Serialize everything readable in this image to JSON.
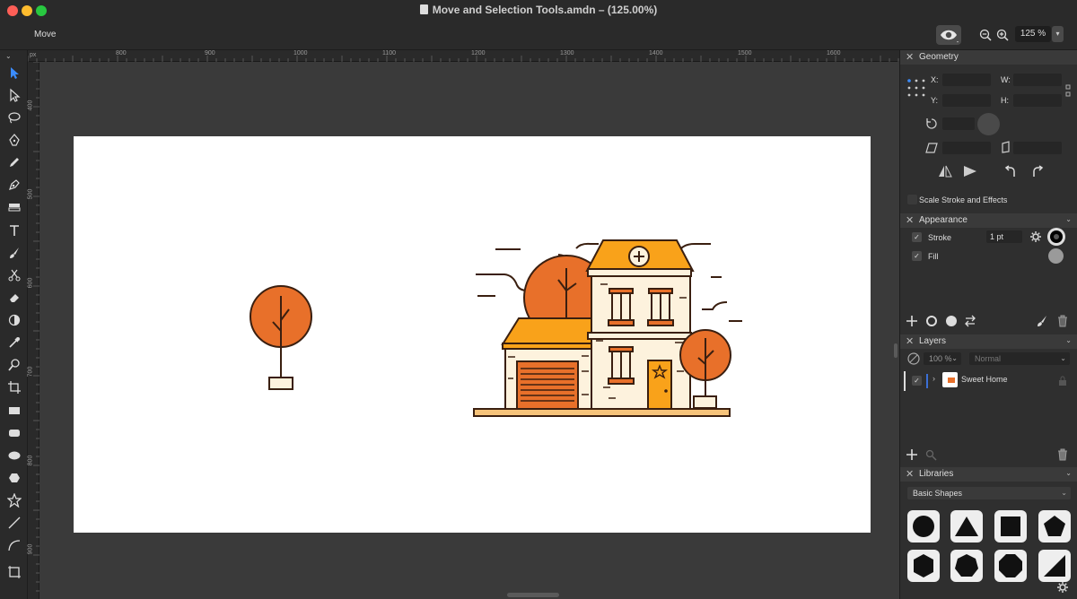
{
  "window": {
    "title": "Move and Selection Tools.amdn – (125.00%)"
  },
  "toolbar": {
    "current_tool": "Move",
    "zoom_value": "125 %",
    "zoom_dropdown_icon": "chevron-down-icon"
  },
  "rulers": {
    "unit": "px",
    "top": [
      "800",
      "900",
      "1000",
      "1100",
      "1200",
      "1300",
      "1400",
      "1500",
      "1600"
    ],
    "left": [
      "400",
      "500",
      "600",
      "700",
      "800",
      "900"
    ]
  },
  "panels": {
    "geometry": {
      "title": "Geometry",
      "x_label": "X:",
      "y_label": "Y:",
      "w_label": "W:",
      "h_label": "H:",
      "scale_stroke_label": "Scale Stroke and Effects"
    },
    "appearance": {
      "title": "Appearance",
      "stroke_label": "Stroke",
      "stroke_value": "1 pt",
      "fill_label": "Fill"
    },
    "layers": {
      "title": "Layers",
      "opacity": "100 %",
      "blend_mode": "Normal",
      "items": [
        {
          "name": "Sweet Home"
        }
      ]
    },
    "libraries": {
      "title": "Libraries",
      "library_select": "Basic Shapes"
    }
  },
  "colors": {
    "orange": "#e8702a",
    "amber": "#f9a21a",
    "cream": "#fdf2dd",
    "line": "#3a1f10",
    "ground": "#f6c37a"
  }
}
